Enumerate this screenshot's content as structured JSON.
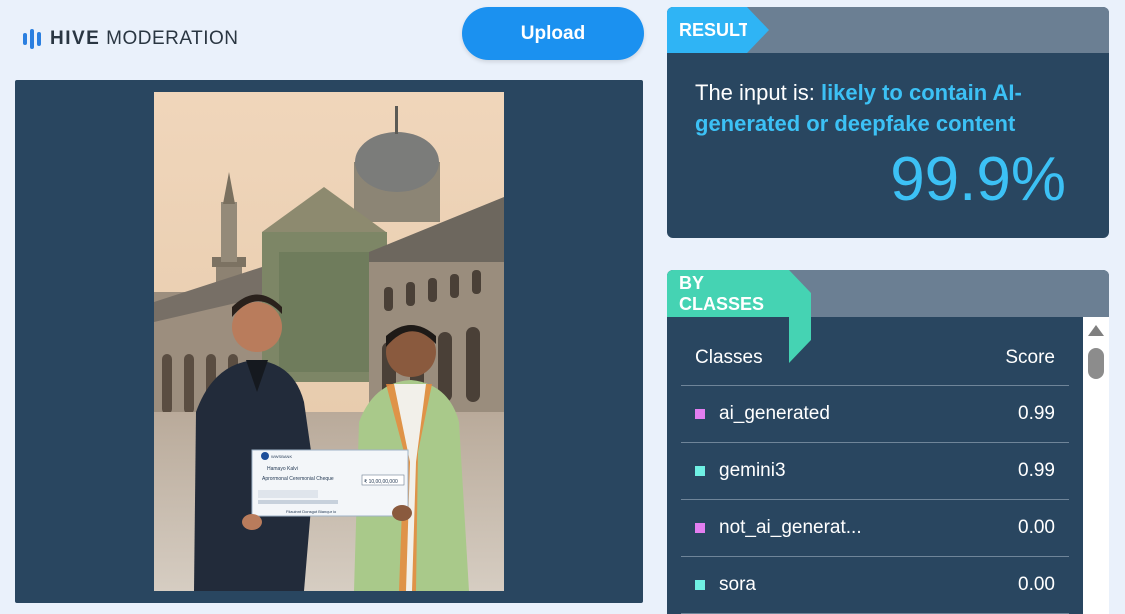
{
  "header": {
    "logo_bold": "HIVE",
    "logo_light": "MODERATION",
    "upload_label": "Upload"
  },
  "result": {
    "tag": "RESULT",
    "prefix": "The input is: ",
    "verdict": "likely to contain AI-generated or deepfake content",
    "score": "99.9%"
  },
  "photo": {
    "cheque_bank": "WWSBANK",
    "cheque_payee": "Hamayo Kalvi",
    "cheque_memo": "Aprormonal Ceremonial Cheque",
    "cheque_amount": "₹ 10,00,00,000",
    "cheque_footer": "Fiiauinnt Donsgut Bianqur io"
  },
  "classes": {
    "tag": "BY CLASSES",
    "col_class": "Classes",
    "col_score": "Score",
    "rows": [
      {
        "name": "ai_generated",
        "score": "0.99",
        "color": "#e27ef0"
      },
      {
        "name": "gemini3",
        "score": "0.99",
        "color": "#6ff0e4"
      },
      {
        "name": "not_ai_generat...",
        "score": "0.00",
        "color": "#e27ef0"
      },
      {
        "name": "sora",
        "score": "0.00",
        "color": "#6ff0e4"
      }
    ]
  },
  "colors": {
    "accent_blue": "#2fb4f5",
    "accent_teal": "#45d3b3",
    "panel_bg": "#294660",
    "button_blue": "#1b91f0"
  }
}
